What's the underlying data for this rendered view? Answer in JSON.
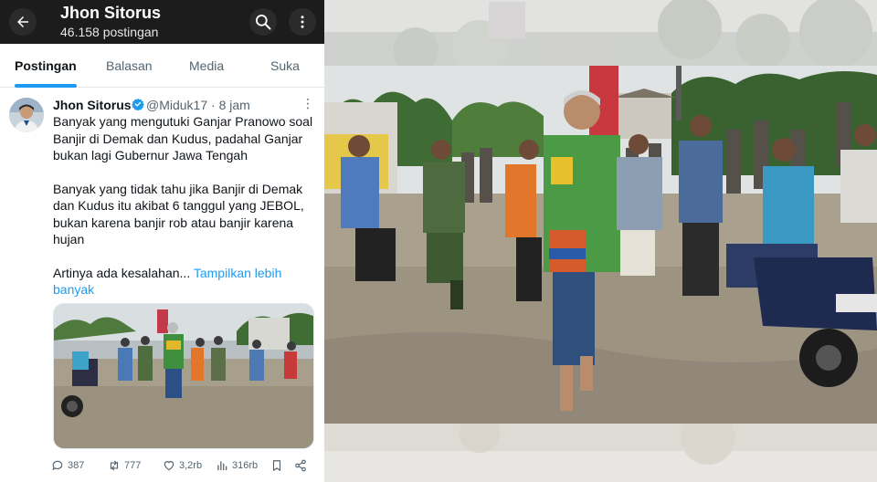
{
  "profile": {
    "name": "Jhon Sitorus",
    "post_count": "46.158 postingan"
  },
  "tabs": [
    {
      "label": "Postingan",
      "active": true
    },
    {
      "label": "Balasan",
      "active": false
    },
    {
      "label": "Media",
      "active": false
    },
    {
      "label": "Suka",
      "active": false
    }
  ],
  "tweet": {
    "author": "Jhon Sitorus",
    "handle_time": "@Miduk17 · 8 jam",
    "paragraph1": "Banyak yang mengutuki Ganjar Pranowo soal Banjir di Demak dan Kudus, padahal Ganjar bukan lagi Gubernur Jawa Tengah",
    "paragraph2": "Banyak yang tidak tahu jika Banjir di Demak dan Kudus itu akibat 6 tanggul yang JEBOL, bukan karena banjir rob atau banjir karena hujan",
    "paragraph3": "Artinya ada kesalahan...",
    "show_more": "Tampilkan lebih banyak",
    "stats": {
      "replies": "387",
      "reposts": "777",
      "likes": "3,2rb",
      "views": "316rb"
    }
  },
  "colors": {
    "accent": "#1d9bf0",
    "topbar": "#1c1c1c",
    "text": "#0f1419",
    "muted": "#536471"
  },
  "icons": [
    "back-arrow-icon",
    "search-icon",
    "more-vertical-icon",
    "verified-badge-icon",
    "reply-icon",
    "repost-icon",
    "like-icon",
    "views-icon",
    "bookmark-icon",
    "share-icon"
  ]
}
